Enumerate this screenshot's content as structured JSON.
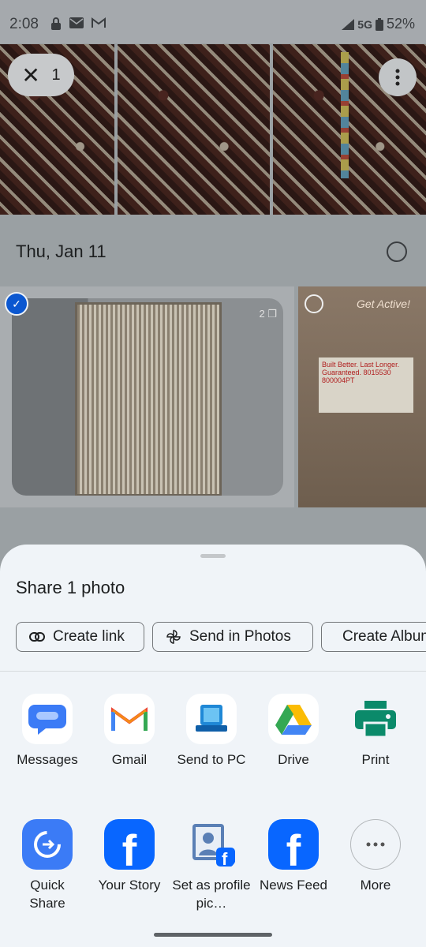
{
  "status": {
    "time": "2:08",
    "network": "5G",
    "battery": "52%",
    "icons": [
      "lock-icon",
      "mail-icon",
      "gmail-icon"
    ]
  },
  "selection": {
    "count": "1"
  },
  "photos": {
    "date_label": "Thu, Jan 11",
    "stack_count": "2",
    "box_text": "Get Active!",
    "box_label": "Built Better. Last Longer. Guaranteed. 8015530 800004PT"
  },
  "sheet": {
    "title": "Share 1 photo",
    "chips": [
      {
        "label": "Create link",
        "icon": "link-icon"
      },
      {
        "label": "Send in Photos",
        "icon": "pinwheel-icon"
      },
      {
        "label": "Create Album",
        "icon": "album-icon"
      }
    ],
    "apps_row1": [
      {
        "label": "Messages"
      },
      {
        "label": "Gmail"
      },
      {
        "label": "Send to PC"
      },
      {
        "label": "Drive"
      },
      {
        "label": "Print"
      }
    ],
    "apps_row2": [
      {
        "label": "Quick Share"
      },
      {
        "label": "Your Story"
      },
      {
        "label": "Set as profile pic…"
      },
      {
        "label": "News Feed"
      },
      {
        "label": "More"
      }
    ]
  },
  "colors": {
    "accent": "#0b57d0",
    "sheet_bg": "#f0f4f8",
    "facebook": "#0866ff"
  }
}
